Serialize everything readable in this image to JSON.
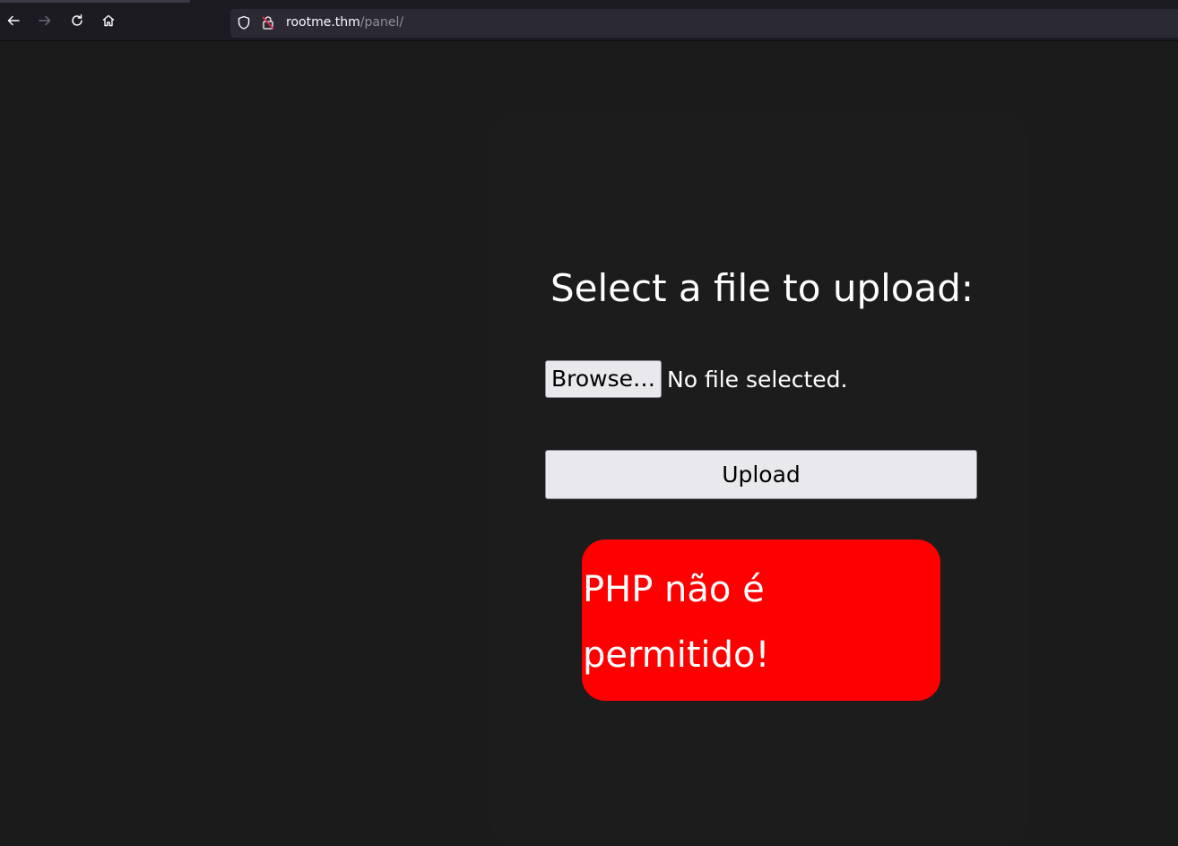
{
  "browser": {
    "back_icon": "arrow-left-icon",
    "forward_icon": "arrow-right-icon",
    "reload_icon": "reload-icon",
    "home_icon": "home-icon",
    "shield_icon": "shield-icon",
    "lock_icon": "insecure-lock-icon",
    "url_host": "rootme.thm",
    "url_path": "/panel/"
  },
  "form": {
    "heading": "Select a file to upload:",
    "browse_label": "Browse…",
    "file_status": "No file selected.",
    "upload_label": "Upload"
  },
  "alert": {
    "message": "PHP não é permitido!",
    "background_color": "#ff0000"
  }
}
